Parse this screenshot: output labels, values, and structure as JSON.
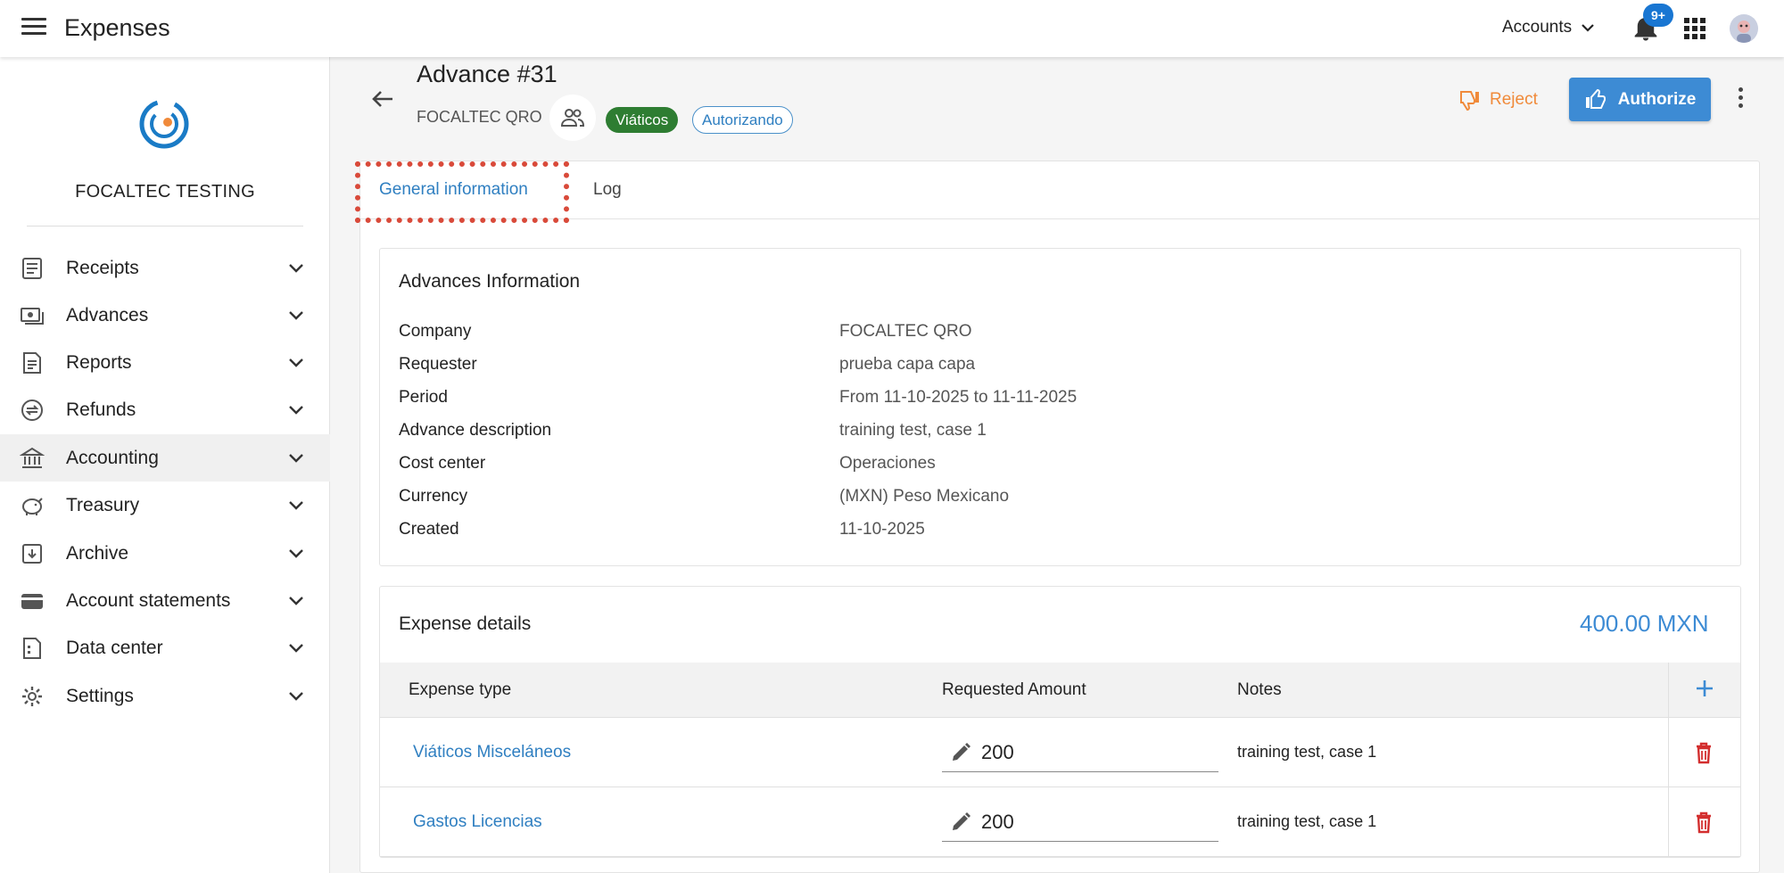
{
  "topbar": {
    "app_title": "Expenses",
    "accounts_label": "Accounts",
    "notification_count": "9+"
  },
  "sidebar": {
    "org_name": "FOCALTEC TESTING",
    "items": [
      {
        "label": "Receipts",
        "icon": "receipt-icon"
      },
      {
        "label": "Advances",
        "icon": "cash-icon"
      },
      {
        "label": "Reports",
        "icon": "report-icon"
      },
      {
        "label": "Refunds",
        "icon": "refund-icon"
      },
      {
        "label": "Accounting",
        "icon": "bank-icon",
        "active": true
      },
      {
        "label": "Treasury",
        "icon": "piggy-bank-icon"
      },
      {
        "label": "Archive",
        "icon": "archive-icon"
      },
      {
        "label": "Account statements",
        "icon": "card-icon"
      },
      {
        "label": "Data center",
        "icon": "data-icon"
      },
      {
        "label": "Settings",
        "icon": "gear-icon"
      }
    ]
  },
  "header": {
    "title": "Advance #31",
    "company": "FOCALTEC QRO",
    "type_chip": "Viáticos",
    "status_chip": "Autorizando",
    "reject_label": "Reject",
    "authorize_label": "Authorize"
  },
  "tabs": [
    {
      "label": "General information",
      "active": true
    },
    {
      "label": "Log",
      "active": false
    }
  ],
  "info": {
    "title": "Advances Information",
    "rows": [
      {
        "label": "Company",
        "value": "FOCALTEC QRO"
      },
      {
        "label": "Requester",
        "value": "prueba capa capa"
      },
      {
        "label": "Period",
        "value": "From 11-10-2025 to 11-11-2025"
      },
      {
        "label": "Advance description",
        "value": "training test, case 1"
      },
      {
        "label": "Cost center",
        "value": "Operaciones"
      },
      {
        "label": "Currency",
        "value": "(MXN) Peso Mexicano"
      },
      {
        "label": "Created",
        "value": "11-10-2025"
      }
    ]
  },
  "expenses": {
    "title": "Expense details",
    "total": "400.00 MXN",
    "columns": [
      "Expense type",
      "Requested Amount",
      "Notes"
    ],
    "rows": [
      {
        "type": "Viáticos Misceláneos",
        "amount": "200",
        "notes": "training test, case 1"
      },
      {
        "type": "Gastos Licencias",
        "amount": "200",
        "notes": "training test, case 1"
      }
    ]
  },
  "colors": {
    "accent": "#3d8bd4",
    "reject": "#f08a3a",
    "chip_green": "#2e7d32",
    "delete": "#d32f2f",
    "highlight": "#d94a3a"
  }
}
